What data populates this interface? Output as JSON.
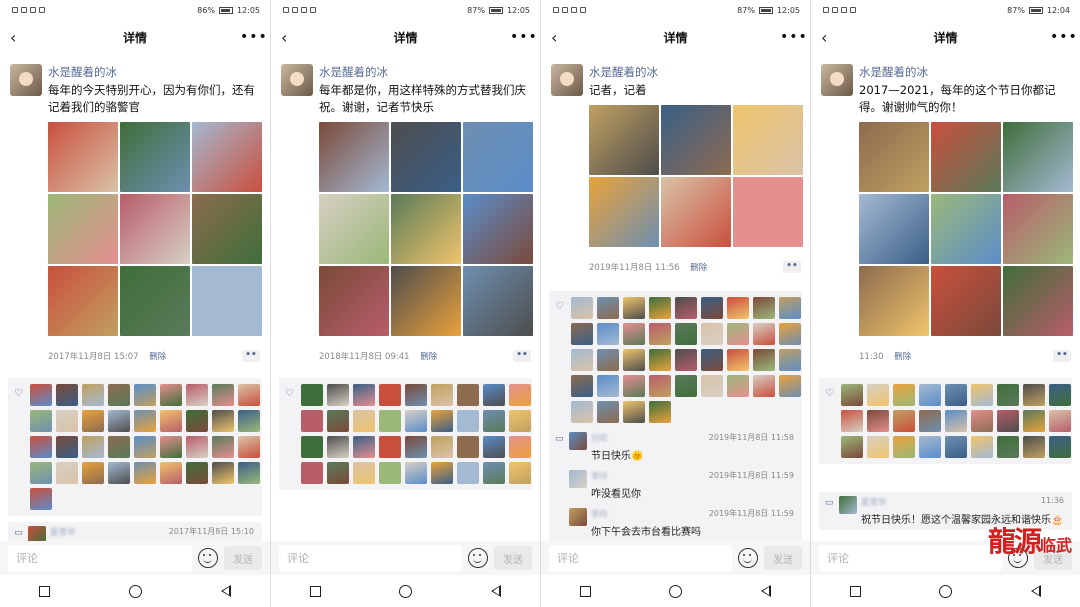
{
  "common": {
    "nav_title": "详情",
    "comment_placeholder": "评论",
    "send_label": "发送",
    "delete_label": "删除",
    "poster_name": "水是醒着的冰",
    "dots": "••"
  },
  "phones": [
    {
      "battery": "86%",
      "clock": "12:05",
      "post_text": "每年的今天特别开心，因为有你们，还有记着我们的骆警官",
      "timestamp": "2017年11月8日 15:07",
      "comments": [
        {
          "name": "夏雪华",
          "time": "2017年11月8日 15:10",
          "text": ""
        }
      ]
    },
    {
      "battery": "87%",
      "clock": "12:05",
      "post_text": "每年都是你，用这样特殊的方式替我们庆祝。谢谢，记者节快乐",
      "timestamp": "2018年11月8日 09:41",
      "comments": []
    },
    {
      "battery": "87%",
      "clock": "12:05",
      "post_text": "记者，记着",
      "timestamp": "2019年11月8日 11:56",
      "comments": [
        {
          "name": "刘欢",
          "time": "2019年11月8日 11:58",
          "text": "节日快乐🌞"
        },
        {
          "name": "李玲",
          "time": "2019年11月8日 11:59",
          "text": "咋没看见你"
        },
        {
          "name": "李玲",
          "time": "2019年11月8日 11:59",
          "text": "你下午会去市台看比赛吗"
        }
      ]
    },
    {
      "battery": "87%",
      "clock": "12:04",
      "post_text": "2017—2021，每年的这个节日你都记得。谢谢帅气的你！",
      "timestamp": "11:30",
      "comments": [
        {
          "name": "夏雪华",
          "time": "11:36",
          "text": "祝节日快乐！愿这个温馨家园永远和谐快乐🎂"
        }
      ]
    }
  ],
  "watermark": {
    "main": "龍源",
    "sub": "临武"
  },
  "colors": {
    "link": "#576b95",
    "panel": "#f3f3f5",
    "watermark": "#d41f1f"
  }
}
